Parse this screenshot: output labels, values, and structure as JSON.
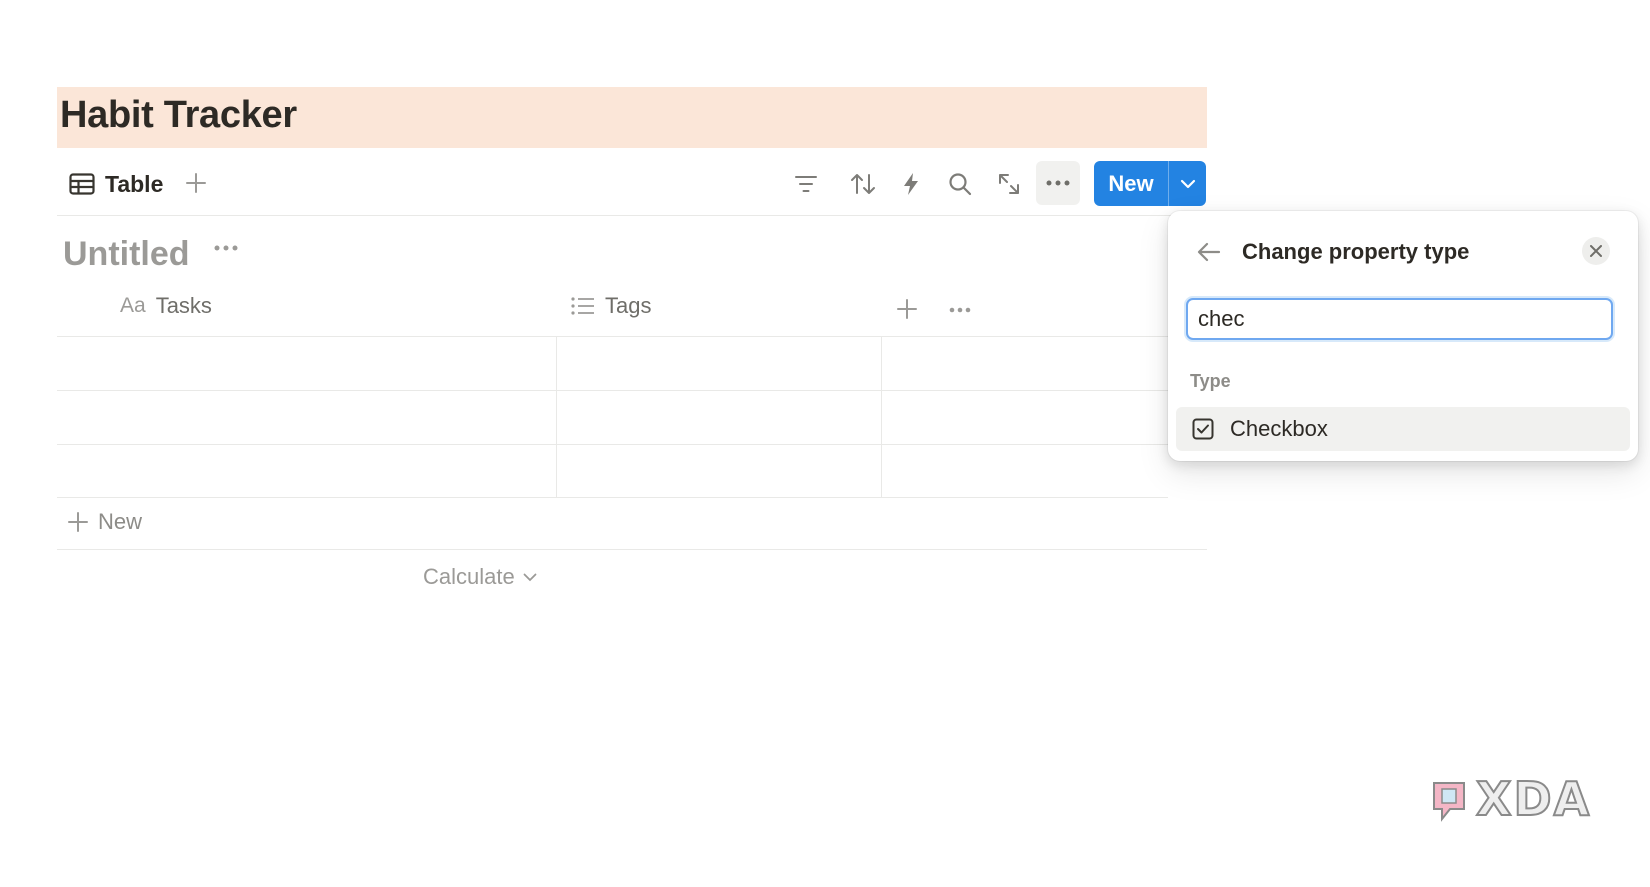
{
  "page": {
    "title": "Habit Tracker"
  },
  "toolbar": {
    "view_label": "Table",
    "icons": [
      "table-icon",
      "plus-icon",
      "filter-icon",
      "sort-icon",
      "lightning-icon",
      "search-icon",
      "expand-icon",
      "more-icon",
      "chevron-down-icon"
    ],
    "new_label": "New"
  },
  "database": {
    "title": "Untitled",
    "columns": [
      {
        "prefix": "Aa",
        "label": "Tasks"
      },
      {
        "label": "Tags"
      }
    ],
    "rows": [
      [
        "",
        ""
      ],
      [
        "",
        ""
      ],
      [
        "",
        ""
      ]
    ],
    "new_row_label": "New",
    "calculate_label": "Calculate"
  },
  "popup": {
    "title": "Change property type",
    "search_value": "chec",
    "section_label": "Type",
    "options": [
      {
        "label": "Checkbox",
        "icon": "checkbox-icon"
      }
    ]
  },
  "watermark": {
    "text": "XDA"
  },
  "colors": {
    "accent": "#2383e2",
    "banner": "#fbe6d8",
    "text": "#37352f",
    "muted": "#9b9a97"
  }
}
